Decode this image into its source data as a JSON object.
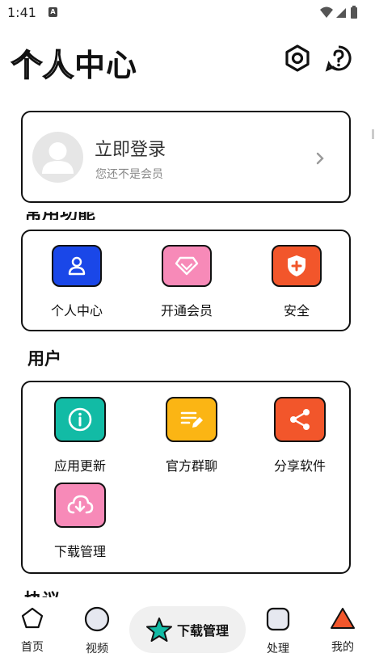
{
  "status_bar": {
    "time": "1:41",
    "sim_label": "A"
  },
  "header": {
    "title_outline": "个人",
    "title_solid": "中心",
    "settings_icon": "gear-icon",
    "help_icon": "help-icon"
  },
  "login_card": {
    "title": "立即登录",
    "subtitle": "您还不是会员"
  },
  "section_peek_top": "常用功能",
  "quick_actions": [
    {
      "label": "个人中心",
      "icon": "person-icon",
      "color": "#1a47e8"
    },
    {
      "label": "开通会员",
      "icon": "diamond-icon",
      "color": "#f78ab8"
    },
    {
      "label": "安全",
      "icon": "shield-icon",
      "color": "#f2562b"
    }
  ],
  "user_section": {
    "title": "用户",
    "items": [
      {
        "label": "应用更新",
        "icon": "info-icon",
        "color": "#12bba5"
      },
      {
        "label": "官方群聊",
        "icon": "document-edit-icon",
        "color": "#fbb514"
      },
      {
        "label": "分享软件",
        "icon": "share-icon",
        "color": "#f2562b"
      },
      {
        "label": "下载管理",
        "icon": "cloud-download-icon",
        "color": "#f78ab8"
      }
    ]
  },
  "section_peek_bottom": "协议",
  "bottom_nav": {
    "home": "首页",
    "video": "视频",
    "center": "下载管理",
    "process": "处理",
    "mine": "我的"
  }
}
